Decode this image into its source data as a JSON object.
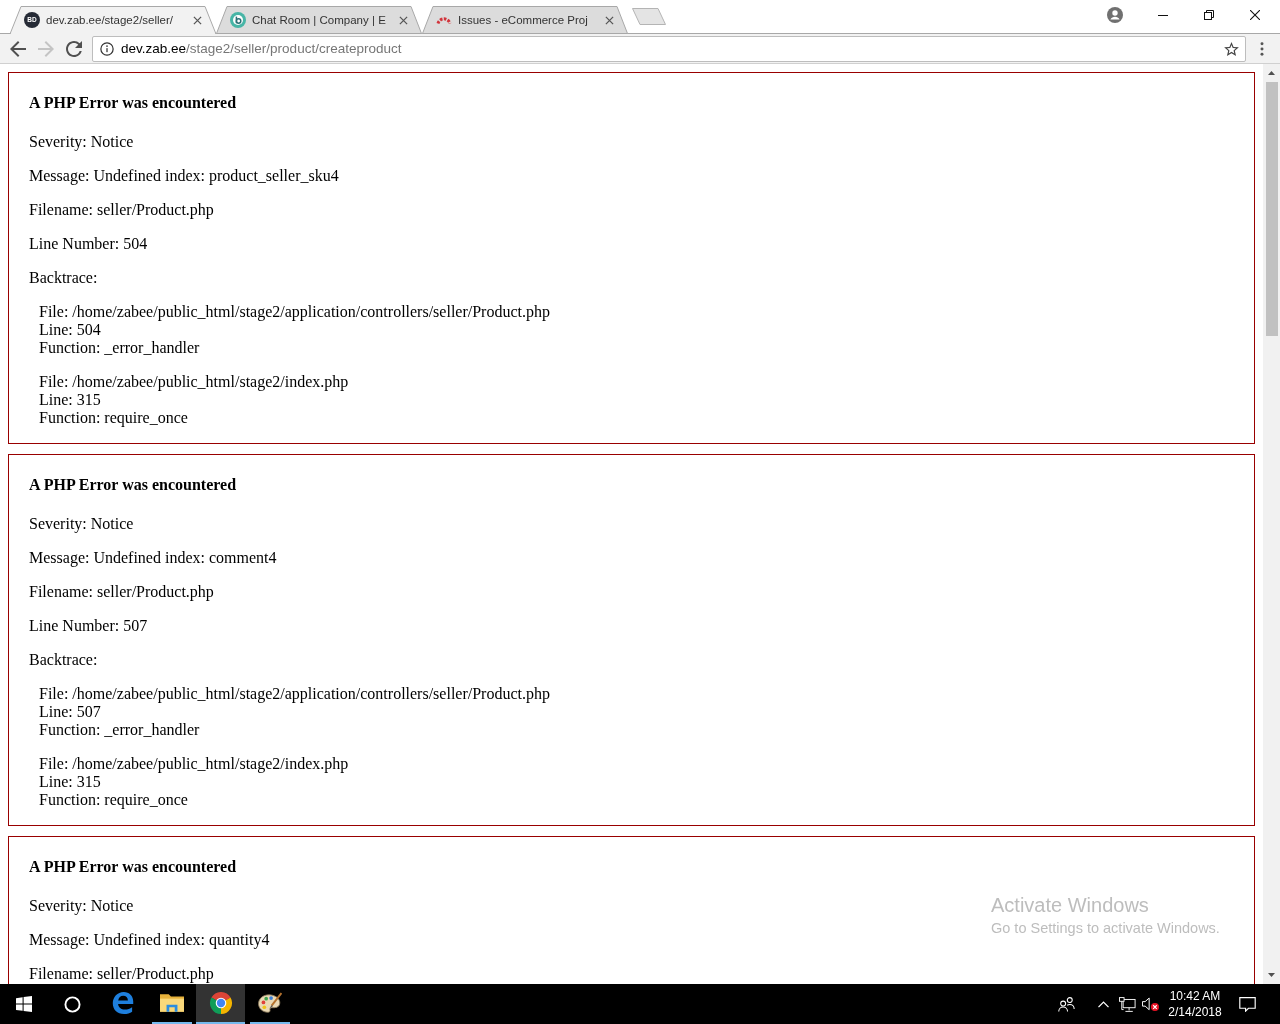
{
  "browser": {
    "tabs": [
      {
        "title": "dev.zab.ee/stage2/seller/",
        "selected": true,
        "favicon": {
          "kind": "monogram",
          "text": "BD"
        }
      },
      {
        "title": "Chat Room | Company | E",
        "selected": false,
        "favicon": {
          "kind": "ring"
        }
      },
      {
        "title": "Issues - eCommerce Proj",
        "selected": false,
        "favicon": {
          "kind": "arc"
        }
      }
    ],
    "nav_buttons": [
      {
        "kind": "back",
        "disabled": false
      },
      {
        "kind": "forward",
        "disabled": true
      },
      {
        "kind": "reload",
        "disabled": false
      }
    ],
    "address_bar": {
      "host": "dev.zab.ee",
      "path": "/stage2/seller/product/createproduct"
    }
  },
  "errors": [
    {
      "heading": "A PHP Error was encountered",
      "details": [
        "Severity: Notice",
        "Message: Undefined index: product_seller_sku4",
        "Filename: seller/Product.php",
        "Line Number: 504"
      ],
      "backtrace_label": "Backtrace:",
      "backtrace": [
        {
          "file": "File: /home/zabee/public_html/stage2/application/controllers/seller/Product.php",
          "line": "Line: 504",
          "function": "Function: _error_handler"
        },
        {
          "file": "File: /home/zabee/public_html/stage2/index.php",
          "line": "Line: 315",
          "function": "Function: require_once"
        }
      ]
    },
    {
      "heading": "A PHP Error was encountered",
      "details": [
        "Severity: Notice",
        "Message: Undefined index: comment4",
        "Filename: seller/Product.php",
        "Line Number: 507"
      ],
      "backtrace_label": "Backtrace:",
      "backtrace": [
        {
          "file": "File: /home/zabee/public_html/stage2/application/controllers/seller/Product.php",
          "line": "Line: 507",
          "function": "Function: _error_handler"
        },
        {
          "file": "File: /home/zabee/public_html/stage2/index.php",
          "line": "Line: 315",
          "function": "Function: require_once"
        }
      ]
    },
    {
      "heading": "A PHP Error was encountered",
      "details": [
        "Severity: Notice",
        "Message: Undefined index: quantity4",
        "Filename: seller/Product.php"
      ]
    }
  ],
  "activation_notice": {
    "title": "Activate Windows",
    "text": "Go to Settings to activate Windows."
  },
  "taskbar": {
    "apps": [
      {
        "kind": "edge",
        "running": false,
        "selected": false
      },
      {
        "kind": "explorer",
        "running": true,
        "selected": false
      },
      {
        "kind": "chrome",
        "running": true,
        "selected": true
      },
      {
        "kind": "paint",
        "running": true,
        "selected": false
      }
    ],
    "volume": {
      "muted": true
    },
    "clock": {
      "time": "10:42 AM",
      "date": "2/14/2018"
    }
  }
}
